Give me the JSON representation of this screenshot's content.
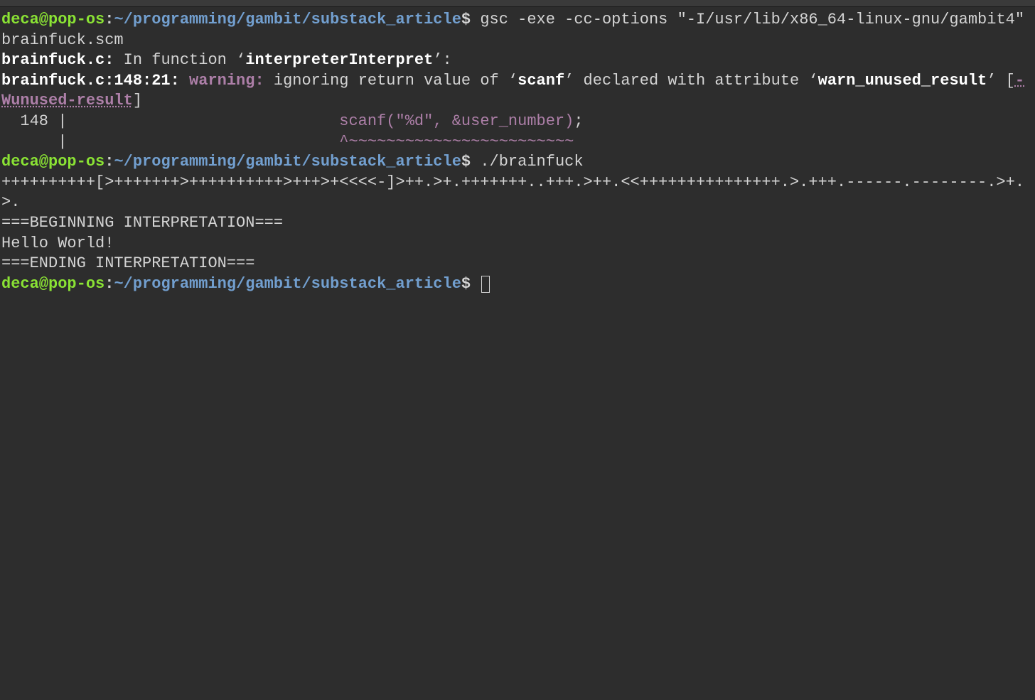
{
  "prompt": {
    "user_host": "deca@pop-os",
    "colon": ":",
    "path": "~/programming/gambit/substack_article",
    "dollar": "$ "
  },
  "line1": {
    "command": "gsc -exe -cc-options \"-I/usr/lib/x86_64-linux-gnu/gambit4\" brainfuck.scm"
  },
  "line2": {
    "file": "brainfuck.c:",
    "text1": " In function ‘",
    "func": "interpreterInterpret",
    "text2": "’:"
  },
  "line3": {
    "loc": "brainfuck.c:148:21: ",
    "warn": "warning: ",
    "text1": "ignoring return value of ‘",
    "scanf": "scanf",
    "text2": "’ declared with attribute ‘",
    "attr": "warn_unused_result",
    "text3": "’ [",
    "flag": "-Wunused-result",
    "text4": "]"
  },
  "line4": {
    "lineno": "  148 |                             ",
    "code": "scanf(\"%d\", &user_number)",
    "semi": ";"
  },
  "line5": {
    "prefix": "      |                             ",
    "caret": "^~~~~~~~~~~~~~~~~~~~~~~~~"
  },
  "line6": {
    "command": "./brainfuck"
  },
  "line7": {
    "text": "++++++++++[>+++++++>++++++++++>+++>+<<<<-]>++.>+.+++++++..+++.>++.<<+++++++++++++++.>.+++.------.--------.>+.>."
  },
  "line8": {
    "text": "===BEGINNING INTERPRETATION==="
  },
  "line9": {
    "text": "Hello World!"
  },
  "line10": {
    "text": ""
  },
  "line11": {
    "text": "===ENDING INTERPRETATION==="
  }
}
